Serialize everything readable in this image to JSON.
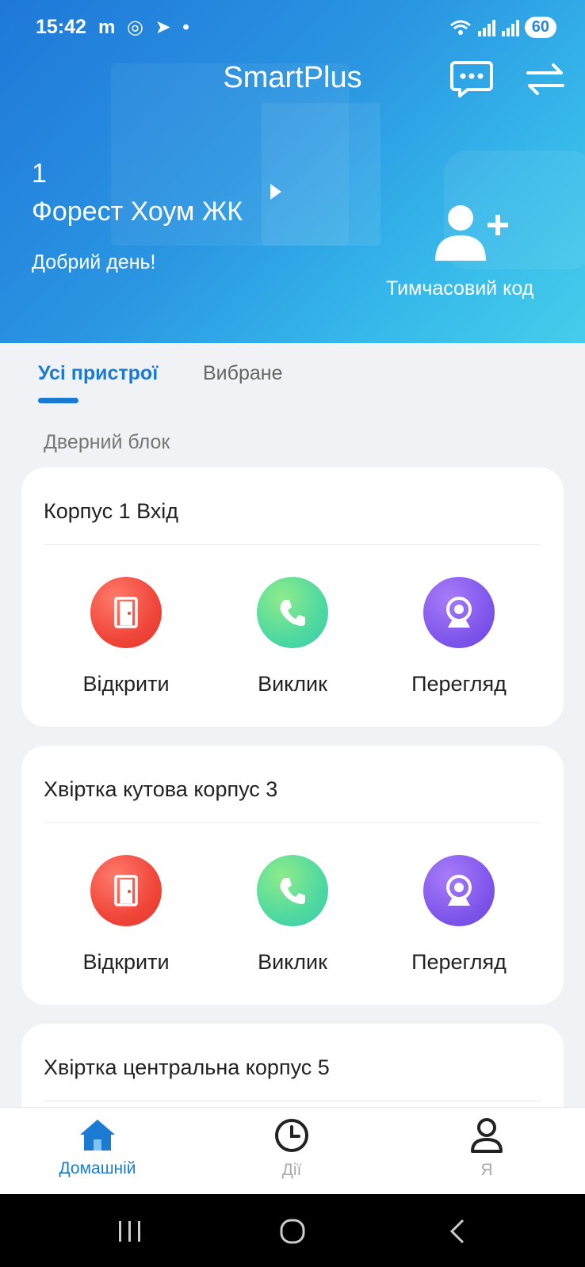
{
  "status_bar": {
    "time": "15:42",
    "notification_icons": "m ◎ ➤ •",
    "battery": "60"
  },
  "header": {
    "title": "SmartPlus",
    "room_number": "1",
    "room_name": "Форест Хоум ЖК",
    "greeting": "Добрий день!",
    "temp_code_label": "Тимчасовий код"
  },
  "tabs": [
    {
      "label": "Усі пристрої",
      "active": true
    },
    {
      "label": "Вибране",
      "active": false
    }
  ],
  "section": {
    "title": "Дверний блок"
  },
  "cards": [
    {
      "title": "Корпус 1 Вхід",
      "actions": [
        "Відкрити",
        "Виклик",
        "Перегляд"
      ]
    },
    {
      "title": "Хвіртка кутова корпус 3",
      "actions": [
        "Відкрити",
        "Виклик",
        "Перегляд"
      ]
    },
    {
      "title": "Хвіртка центральна корпус 5"
    }
  ],
  "bottom_nav": [
    {
      "label": "Домашній",
      "icon": "home-icon",
      "active": true
    },
    {
      "label": "Дії",
      "icon": "clock-icon",
      "active": false
    },
    {
      "label": "Я",
      "icon": "user-icon",
      "active": false
    }
  ],
  "colors": {
    "accent": "#1b7bd2",
    "open": "#f0463a",
    "call": "#4fd9a0",
    "view": "#7d54ea"
  }
}
